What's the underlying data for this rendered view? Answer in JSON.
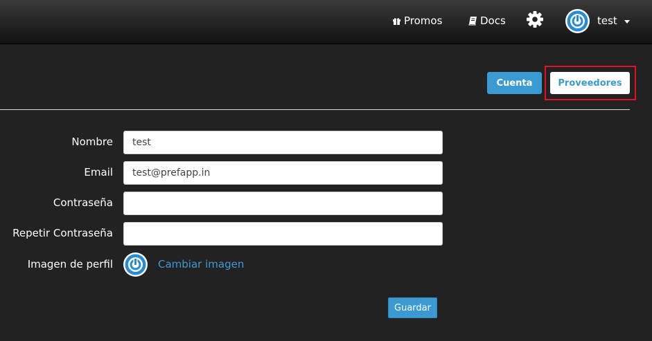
{
  "colors": {
    "background": "#222222",
    "accent": "#3c9ad2",
    "highlight": "#e0141e"
  },
  "nav": {
    "promos_label": "Promos",
    "promos_icon": "gift-icon",
    "docs_label": "Docs",
    "docs_icon": "book-icon",
    "settings_icon": "gear-icon",
    "user_name": "test",
    "user_avatar_icon": "power-icon",
    "user_menu_icon": "caret-down-icon"
  },
  "tabs": {
    "cuenta_label": "Cuenta",
    "proveedores_label": "Proveedores"
  },
  "form": {
    "nombre_label": "Nombre",
    "nombre_value": "test",
    "email_label": "Email",
    "email_value": "test@prefapp.in",
    "password_label": "Contraseña",
    "password_value": "",
    "repeat_password_label": "Repetir Contraseña",
    "repeat_password_value": "",
    "profile_image_label": "Imagen de perfil",
    "change_image_label": "Cambiar imagen",
    "save_label": "Guardar"
  }
}
